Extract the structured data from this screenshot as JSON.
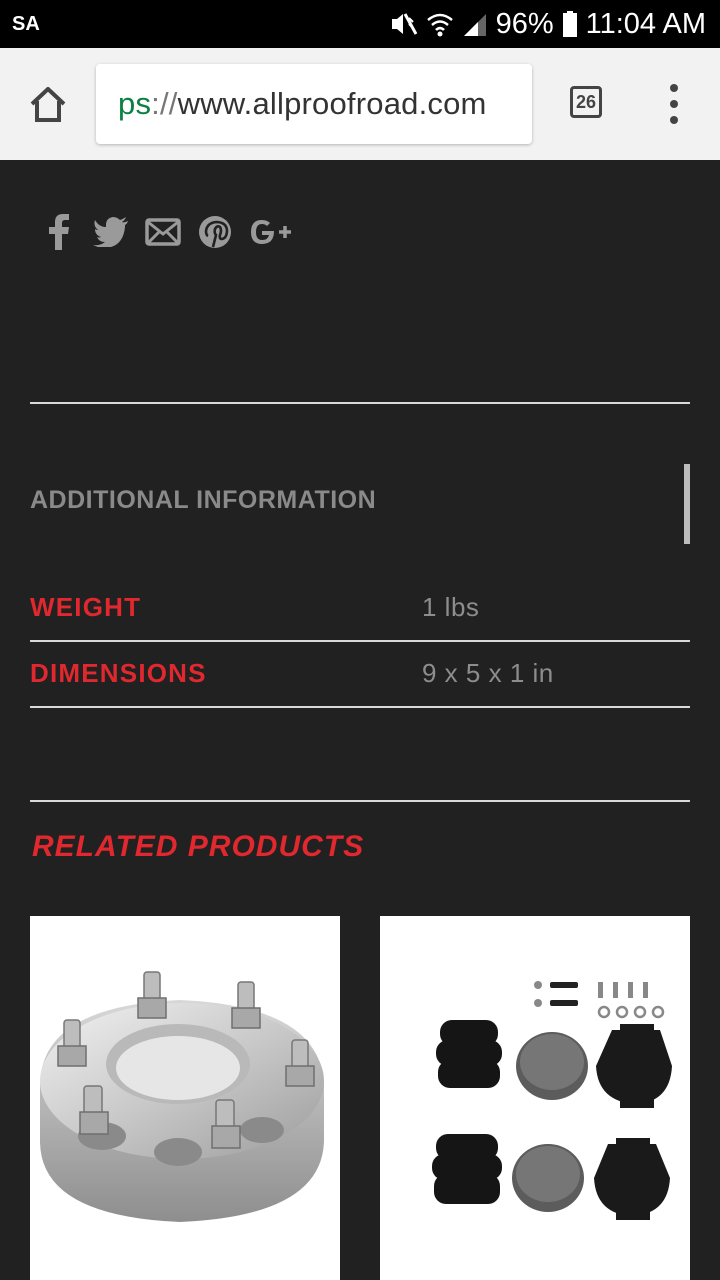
{
  "status_bar": {
    "carrier": "SA",
    "battery": "96%",
    "time": "11:04 AM"
  },
  "browser": {
    "url_scheme_partial": "ps",
    "url_separator": "://",
    "url_host": "www.allproofroad.com",
    "tab_count": "26"
  },
  "social": [
    "facebook-icon",
    "twitter-icon",
    "email-icon",
    "pinterest-icon",
    "google-plus-icon"
  ],
  "additional_info": {
    "title": "ADDITIONAL INFORMATION",
    "rows": [
      {
        "label": "WEIGHT",
        "value": "1 lbs"
      },
      {
        "label": "DIMENSIONS",
        "value": "9 x 5 x 1 in"
      }
    ]
  },
  "related": {
    "title": "RELATED PRODUCTS",
    "products": [
      {
        "image": "wheel-spacer-image"
      },
      {
        "image": "bump-stop-kit-image"
      }
    ]
  },
  "colors": {
    "background": "#212121",
    "accent": "#e0282e",
    "muted_text": "#8a8a8a"
  }
}
